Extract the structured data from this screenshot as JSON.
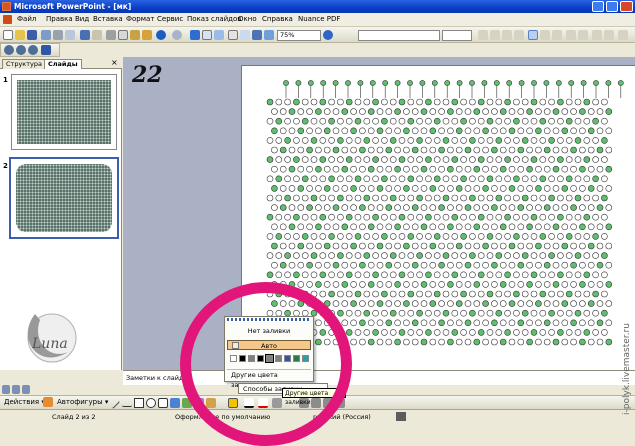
{
  "titlebar": {
    "title": "Microsoft PowerPoint - [мк]"
  },
  "menu": [
    "Файл",
    "Правка",
    "Вид",
    "Вставка",
    "Формат",
    "Сервис",
    "Показ слайдов",
    "Окно",
    "Справка",
    "Nuance PDF"
  ],
  "toolbar": {
    "zoom": "75%"
  },
  "tabs": {
    "structure": "Структура",
    "slides": "Слайды",
    "close": "×"
  },
  "slides": [
    {
      "num": "1"
    },
    {
      "num": "2"
    }
  ],
  "slide_label": "22",
  "logo_text": "Luna",
  "notes": {
    "placeholder": "Заметки к слайду"
  },
  "drawbar": {
    "actions": "Действия ▾",
    "autoshapes": "Автофигуры ▾"
  },
  "fill_popup": {
    "no_fill": "Нет заливки",
    "auto": "Авто",
    "more_colors": "Другие цвета заливки...",
    "fill_effects": "Способы заливки...",
    "swatches": [
      "#ffffff",
      "#000000",
      "#808080",
      "#000000",
      "#808080",
      "#7f7f7f",
      "#3a4fa8",
      "#2b7a4b",
      "#2aa0a0"
    ]
  },
  "tooltip": "Другие цвета заливки",
  "status": {
    "slide": "Слайд 2 из 2",
    "design": "Оформление по умолчанию",
    "lang": "русский (Россия)"
  },
  "watermark": "i-polyk.livemaster.ru"
}
